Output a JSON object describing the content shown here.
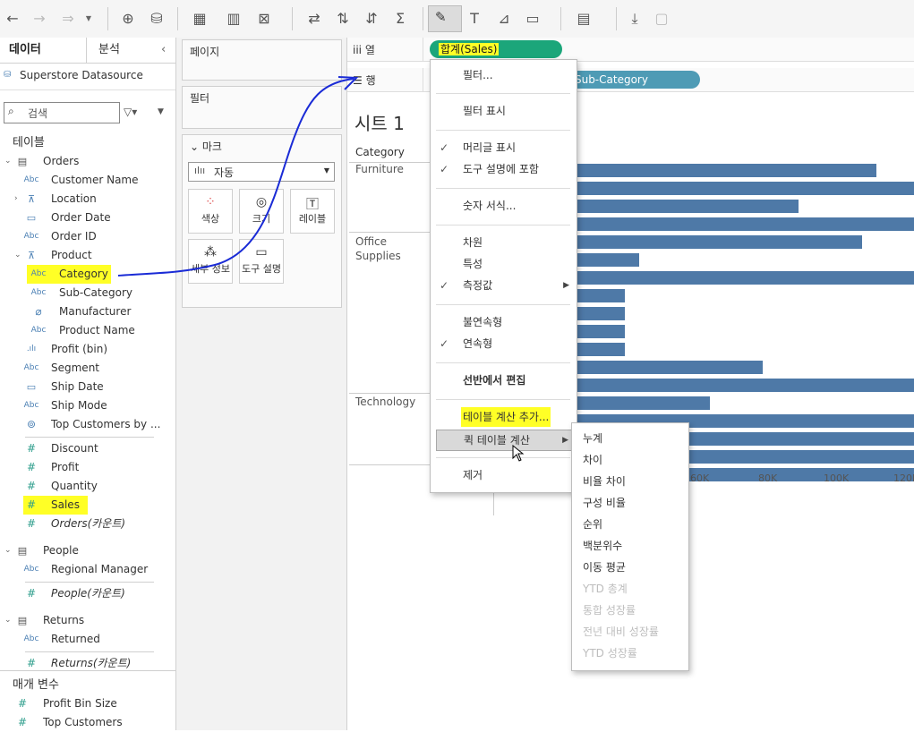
{
  "left_pane": {
    "tabs": [
      "데이터",
      "분석"
    ],
    "datasource": "Superstore Datasource",
    "search_placeholder": "검색",
    "tables_header": "테이블",
    "orders": {
      "name": "Orders",
      "fields": [
        {
          "icon": "Abc",
          "label": "Customer Name"
        },
        {
          "icon": "hier",
          "label": "Location"
        },
        {
          "icon": "date",
          "label": "Order Date"
        },
        {
          "icon": "Abc",
          "label": "Order ID"
        },
        {
          "icon": "hier",
          "label": "Product"
        }
      ],
      "product_children": [
        {
          "icon": "Abc",
          "label": "Category"
        },
        {
          "icon": "Abc",
          "label": "Sub-Category"
        },
        {
          "icon": "clip",
          "label": "Manufacturer"
        },
        {
          "icon": "Abc",
          "label": "Product Name"
        }
      ],
      "more_fields": [
        {
          "icon": "bin",
          "label": "Profit (bin)"
        },
        {
          "icon": "Abc",
          "label": "Segment"
        },
        {
          "icon": "date",
          "label": "Ship Date"
        },
        {
          "icon": "Abc",
          "label": "Ship Mode"
        },
        {
          "icon": "set",
          "label": "Top Customers by ..."
        }
      ],
      "measures": [
        "Discount",
        "Profit",
        "Quantity",
        "Sales",
        "Orders(카운트)"
      ]
    },
    "people": {
      "name": "People",
      "fields": [
        "Regional Manager"
      ],
      "count": "People(카운트)"
    },
    "returns": {
      "name": "Returns",
      "fields": [
        "Returned"
      ],
      "count": "Returns(카운트)"
    },
    "params_header": "매개 변수",
    "params": [
      "Profit Bin Size",
      "Top Customers"
    ]
  },
  "shelves": {
    "pages": "페이지",
    "filters": "필터",
    "marks": "마크",
    "mark_type": "자동",
    "mark_buttons": [
      "색상",
      "크기",
      "레이블",
      "세부 정보",
      "도구 설명"
    ]
  },
  "canvas": {
    "columns_label": "열",
    "rows_label": "행",
    "column_pill": "합계(Sales)",
    "row_pill": "Sub-Category",
    "sheet_title": "시트 1",
    "category_header": "Category",
    "categories": [
      "Furniture",
      "Office Supplies",
      "Technology"
    ],
    "axis_ticks": [
      "60K",
      "80K",
      "100K",
      "120K"
    ]
  },
  "chart_data": {
    "type": "bar",
    "categories": [
      "Furniture",
      "Office Supplies",
      "Technology"
    ],
    "axis_ticks": [
      "60K",
      "80K",
      "100K",
      "120K"
    ],
    "values_visible_K": [
      109,
      120,
      87,
      120,
      105,
      42,
      120,
      38,
      38,
      38,
      38,
      77,
      120,
      62,
      120,
      120,
      120,
      120
    ]
  },
  "context_menu": {
    "items": [
      {
        "label": "필터...",
        "check": false
      },
      {
        "label": "필터 표시",
        "check": false
      },
      {
        "label": "머리글 표시",
        "check": true
      },
      {
        "label": "도구 설명에 포함",
        "check": true
      },
      {
        "label": "숫자 서식...",
        "check": false
      },
      {
        "label": "차원",
        "check": false
      },
      {
        "label": "특성",
        "check": false
      },
      {
        "label": "측정값",
        "check": true
      },
      {
        "label": "불연속형",
        "check": false
      },
      {
        "label": "연속형",
        "check": true
      },
      {
        "label": "선반에서 편집",
        "check": false
      },
      {
        "label": "테이블 계산 추가...",
        "check": false
      },
      {
        "label": "퀵 테이블 계산",
        "check": false
      },
      {
        "label": "제거",
        "check": false
      }
    ]
  },
  "submenu": {
    "items": [
      "누계",
      "차이",
      "비율 차이",
      "구성 비율",
      "순위",
      "백분위수",
      "이동 평균"
    ],
    "disabled_items": [
      "YTD 총계",
      "통합 성장률",
      "전년 대비 성장률",
      "YTD 성장률"
    ]
  },
  "colors": {
    "bar": "#4e79a7",
    "pill_green": "#1ba67a",
    "pill_blue": "#4e9bb5",
    "highlight": "#ffff26",
    "annotation": "#1a2bd6"
  }
}
